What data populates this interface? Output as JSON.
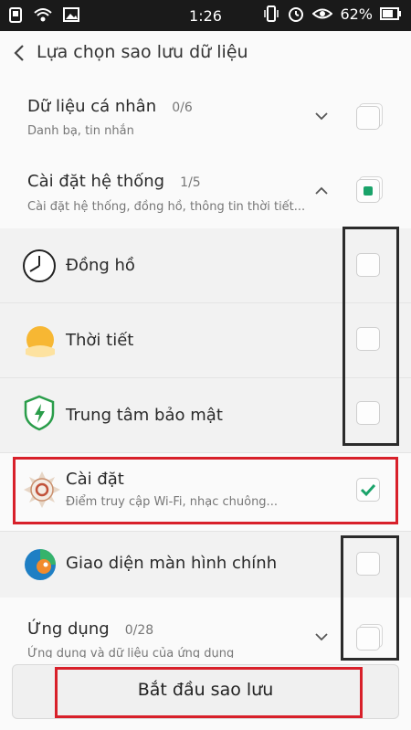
{
  "status": {
    "time": "1:26",
    "battery": "62%"
  },
  "header": {
    "title": "Lựa chọn sao lưu dữ liệu"
  },
  "sections": [
    {
      "title": "Dữ liệu cá nhân",
      "count": "0/6",
      "subtitle": "Danh bạ, tin nhắn"
    },
    {
      "title": "Cài đặt hệ thống",
      "count": "1/5",
      "subtitle": "Cài đặt hệ thống, đồng hồ, thông tin thời tiết..."
    }
  ],
  "items": [
    {
      "title": "Đồng hồ",
      "icon": "clock-icon",
      "checked": false
    },
    {
      "title": "Thời tiết",
      "icon": "weather-icon",
      "checked": false
    },
    {
      "title": "Trung tâm bảo mật",
      "icon": "shield-icon",
      "checked": false
    },
    {
      "title": "Cài đặt",
      "subtitle": "Điểm truy cập Wi-Fi, nhạc chuông...",
      "icon": "settings-gear-icon",
      "checked": true
    },
    {
      "title": "Giao diện màn hình chính",
      "icon": "theme-icon",
      "checked": false
    }
  ],
  "apps_section": {
    "title": "Ứng dụng",
    "count": "0/28",
    "subtitle": "Ứng dụng và dữ liệu của ứng dụng"
  },
  "button": {
    "label": "Bắt đầu sao lưu"
  },
  "colors": {
    "accent": "#1aa36a",
    "highlight_red": "#d8202a",
    "highlight_black": "#2b2b2b"
  }
}
